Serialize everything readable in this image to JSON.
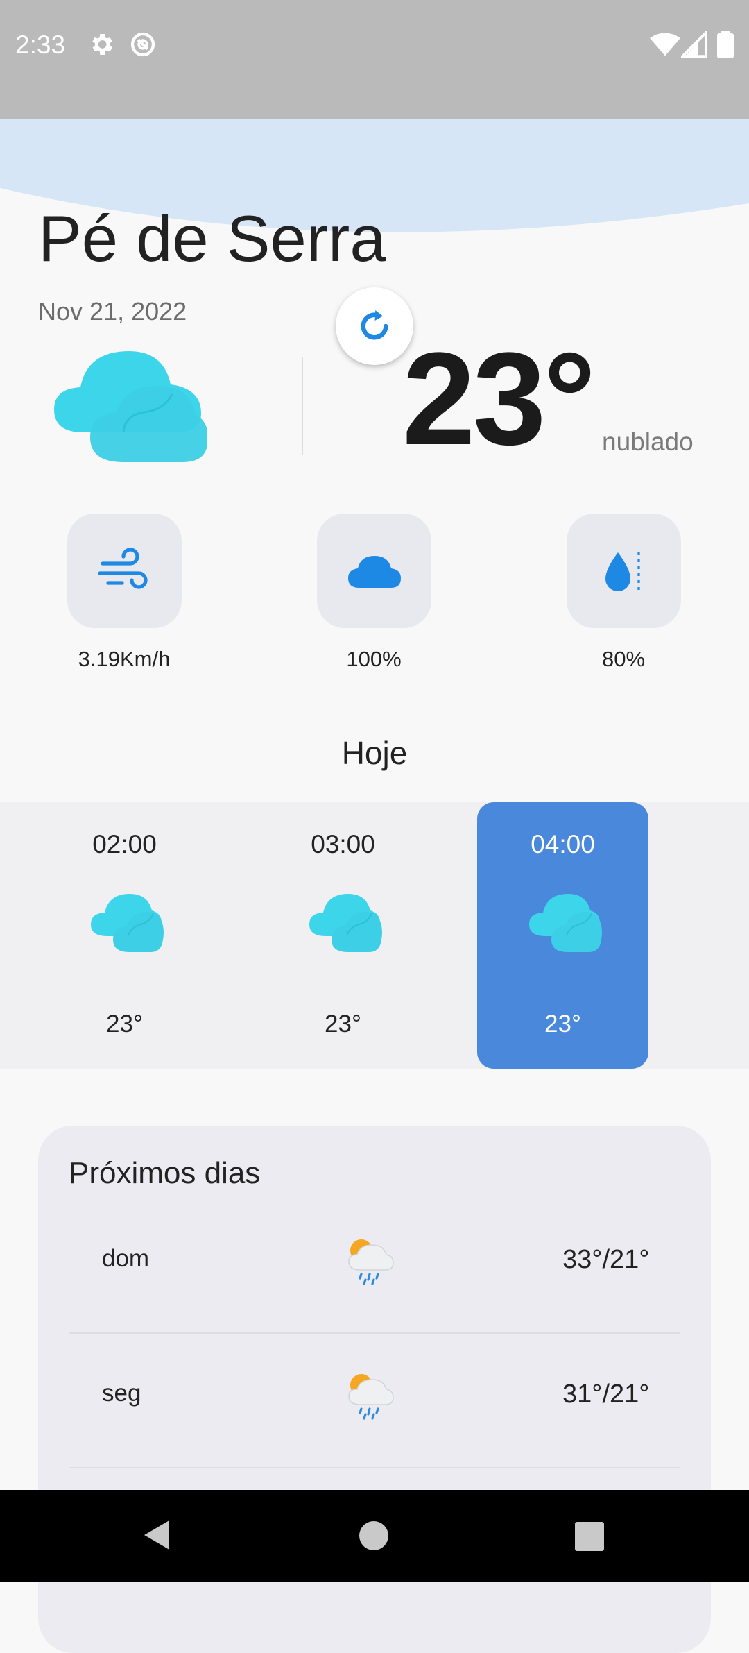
{
  "status_bar": {
    "time": "2:33"
  },
  "location": {
    "city": "Pé de Serra",
    "date": "Nov 21, 2022"
  },
  "current": {
    "temperature": "23°",
    "condition": "nublado"
  },
  "stats": [
    {
      "icon": "wind-icon",
      "value": "3.19Km/h"
    },
    {
      "icon": "cloud-icon",
      "value": "100%"
    },
    {
      "icon": "humidity-icon",
      "value": "80%"
    }
  ],
  "today": {
    "title": "Hoje",
    "hours": [
      {
        "time": "02:00",
        "temp": "23°",
        "icon": "partly-cloudy-icon"
      },
      {
        "time": "03:00",
        "temp": "23°",
        "icon": "partly-cloudy-icon"
      },
      {
        "time": "04:00",
        "temp": "23°",
        "icon": "partly-cloudy-icon",
        "selected": true
      }
    ]
  },
  "next_days": {
    "title": "Próximos dias",
    "days": [
      {
        "day": "dom",
        "icon": "sun-rain-cloud-icon",
        "temps": "33°/21°"
      },
      {
        "day": "seg",
        "icon": "sun-rain-cloud-icon",
        "temps": "31°/21°"
      }
    ]
  },
  "colors": {
    "accent": "#4a88dc",
    "cloud": "#3dd5ea",
    "status_bar": "#bababa",
    "icon_blue": "#1e88e5"
  }
}
